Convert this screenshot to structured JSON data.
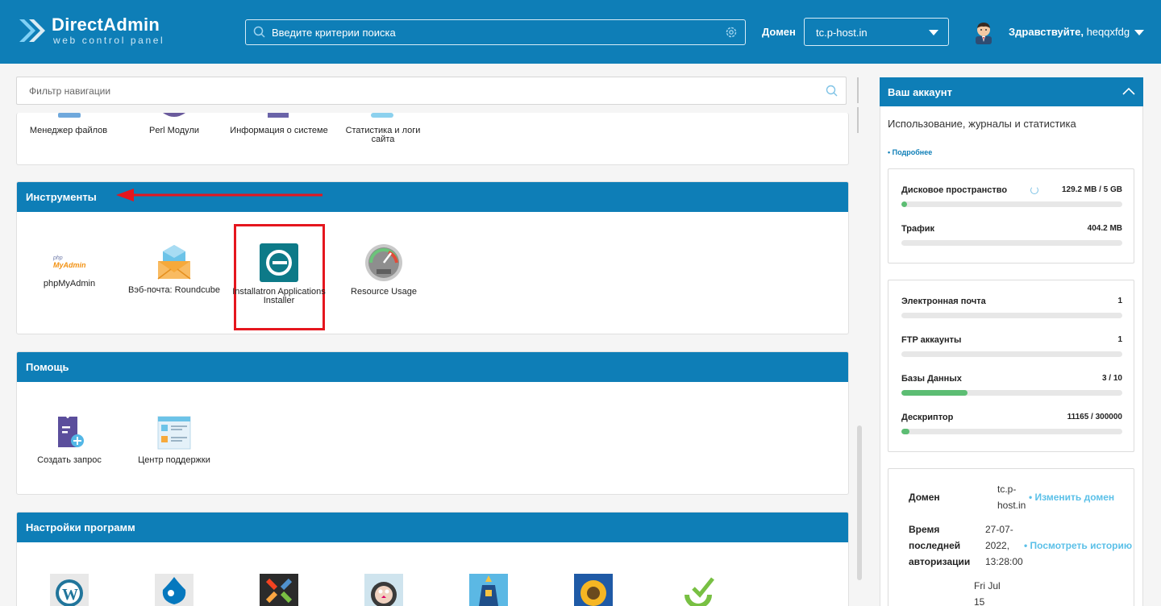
{
  "header": {
    "brand": "DirectAdmin",
    "brand_sub": "web control panel",
    "search_placeholder": "Введите критерии поиска",
    "domain_label": "Домен",
    "domain_value": "tc.p-host.in",
    "greeting": "Здравствуйте,",
    "username": "heqqxfdg"
  },
  "nav_filter": {
    "placeholder": "Фильтр навигации"
  },
  "top_tiles": [
    {
      "label": "Менеджер файлов",
      "icon": "file-manager-icon"
    },
    {
      "label": "Perl Модули",
      "icon": "perl-icon"
    },
    {
      "label": "Информация о системе",
      "icon": "system-info-icon"
    },
    {
      "label": "Статистика и логи сайта",
      "icon": "site-stats-icon"
    }
  ],
  "tools": {
    "title": "Инструменты",
    "tiles": [
      {
        "label": "phpMyAdmin",
        "icon": "phpmyadmin-icon"
      },
      {
        "label": "Вэб-почта: Roundcube",
        "icon": "webmail-icon"
      },
      {
        "label": "Installatron Applications Installer",
        "icon": "installatron-icon"
      },
      {
        "label": "Resource Usage",
        "icon": "resource-usage-icon"
      }
    ]
  },
  "help": {
    "title": "Помощь",
    "tiles": [
      {
        "label": "Создать запрос",
        "icon": "create-ticket-icon"
      },
      {
        "label": "Центр поддержки",
        "icon": "support-center-icon"
      }
    ]
  },
  "app_settings": {
    "title": "Настройки программ",
    "icons": [
      "wordpress-icon",
      "drupal-icon",
      "joomla-icon",
      "prestashop-icon",
      "lighthouse-icon",
      "sunflower-icon",
      "recycle-icon"
    ]
  },
  "account": {
    "title": "Ваш аккаунт",
    "description": "Использование, журналы и статистика",
    "more": "• Подробнее",
    "usage": [
      {
        "name": "Дисковое пространство",
        "value": "129.2 MB / 5 GB",
        "fraction": 0.025
      },
      {
        "name": "Трафик",
        "value": "404.2 MB",
        "fraction": 0
      }
    ],
    "counts": [
      {
        "name": "Электронная почта",
        "value": "1",
        "fraction": 0
      },
      {
        "name": "FTP аккаунты",
        "value": "1",
        "fraction": 0
      },
      {
        "name": "Базы Данных",
        "value": "3 / 10",
        "fraction": 0.3
      },
      {
        "name": "Дескриптор",
        "value": "11165 / 300000",
        "fraction": 0.037
      }
    ],
    "info": {
      "domain_label": "Домен",
      "domain_value_1": "tc.p-",
      "domain_value_2": "host.in",
      "change_domain": "• Изменить домен",
      "login_label_1": "Время",
      "login_label_2": "последней",
      "login_label_3": "авторизации",
      "login_value_1": "27-07-",
      "login_value_2": "2022,",
      "login_value_3": "13:28:00",
      "history": "• Посмотреть историю",
      "extra_1": "Fri Jul",
      "extra_2": "15"
    }
  },
  "colors": {
    "primary": "#0e7eb7",
    "highlight": "#e5161e",
    "bar_fill": "#5cbd73",
    "link": "#5bc0e8"
  }
}
